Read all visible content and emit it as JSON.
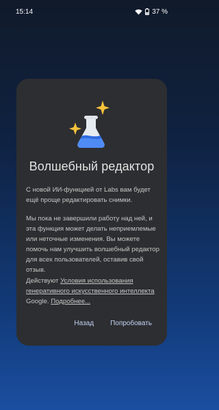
{
  "status_bar": {
    "time": "15:14",
    "battery": "37 %",
    "icons": [
      "wifi-icon",
      "battery-icon"
    ]
  },
  "dialog": {
    "illustration": "flask-sparkles-icon",
    "title": "Волшебный редактор",
    "paragraph1": "С новой ИИ-функцией от Labs вам будет ещё проще редактировать снимки.",
    "paragraph2": "Мы пока не завершили работу над ней, и эта функция может делать неприемлемые или неточные изменения. Вы можете помочь нам улучшить волшебный редактор для всех пользователей, оставив свой отзыв.",
    "paragraph3_prefix": "Действуют ",
    "terms_link": "Условия использования генеративного искусственного интеллекта",
    "paragraph3_mid": " Google. ",
    "more_link": "Подробнее...",
    "back_button": "Назад",
    "try_button": "Попробовать"
  },
  "colors": {
    "dialog_bg": "#2d2e31",
    "accent_text": "#c2d3f5",
    "flask_blue": "#4f8bf5",
    "sparkle_yellow": "#f9c23c"
  }
}
